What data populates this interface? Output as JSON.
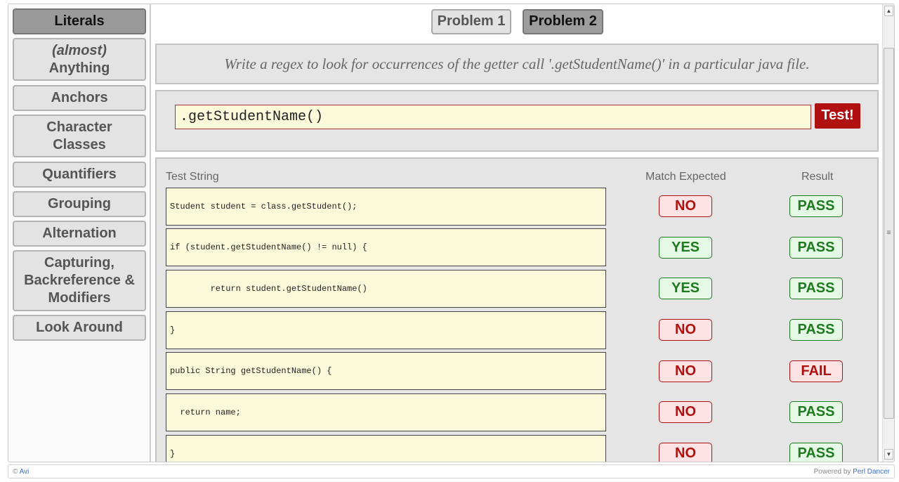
{
  "sidebar": {
    "items": [
      {
        "label": "Literals"
      },
      {
        "label_top": "(almost)",
        "label": "Anything"
      },
      {
        "label": "Anchors"
      },
      {
        "label": "Character",
        "label_bottom": "Classes"
      },
      {
        "label": "Quantifiers"
      },
      {
        "label": "Grouping"
      },
      {
        "label": "Alternation"
      },
      {
        "label": "Capturing,",
        "label_2": "Backreference &",
        "label_3": "Modifiers"
      },
      {
        "label": "Look Around"
      }
    ]
  },
  "problems": {
    "problem1": "Problem 1",
    "problem2": "Problem 2"
  },
  "description": "Write a regex to look for occurrences of the getter call '.getStudentName()' in a particular java file.",
  "regex": {
    "value": ".getStudentName()",
    "test_label": "Test!"
  },
  "table": {
    "headers": {
      "test_string": "Test String",
      "match_expected": "Match Expected",
      "result": "Result"
    },
    "rows": [
      {
        "text": "Student student = class.getStudent();",
        "expected": "NO",
        "result": "PASS"
      },
      {
        "text": "if (student.getStudentName() != null) {",
        "expected": "YES",
        "result": "PASS"
      },
      {
        "text": "        return student.getStudentName()",
        "expected": "YES",
        "result": "PASS"
      },
      {
        "text": "}",
        "expected": "NO",
        "result": "PASS"
      },
      {
        "text": "public String getStudentName() {",
        "expected": "NO",
        "result": "FAIL"
      },
      {
        "text": "  return name;",
        "expected": "NO",
        "result": "PASS"
      },
      {
        "text": "}",
        "expected": "NO",
        "result": "PASS"
      }
    ]
  },
  "footer": {
    "copyright": "©",
    "author": "Avi",
    "powered_by": "Powered by",
    "framework": "Perl Dancer"
  },
  "icons": {
    "scroll_up": "up-arrow-icon",
    "scroll_down": "down-arrow-icon"
  }
}
